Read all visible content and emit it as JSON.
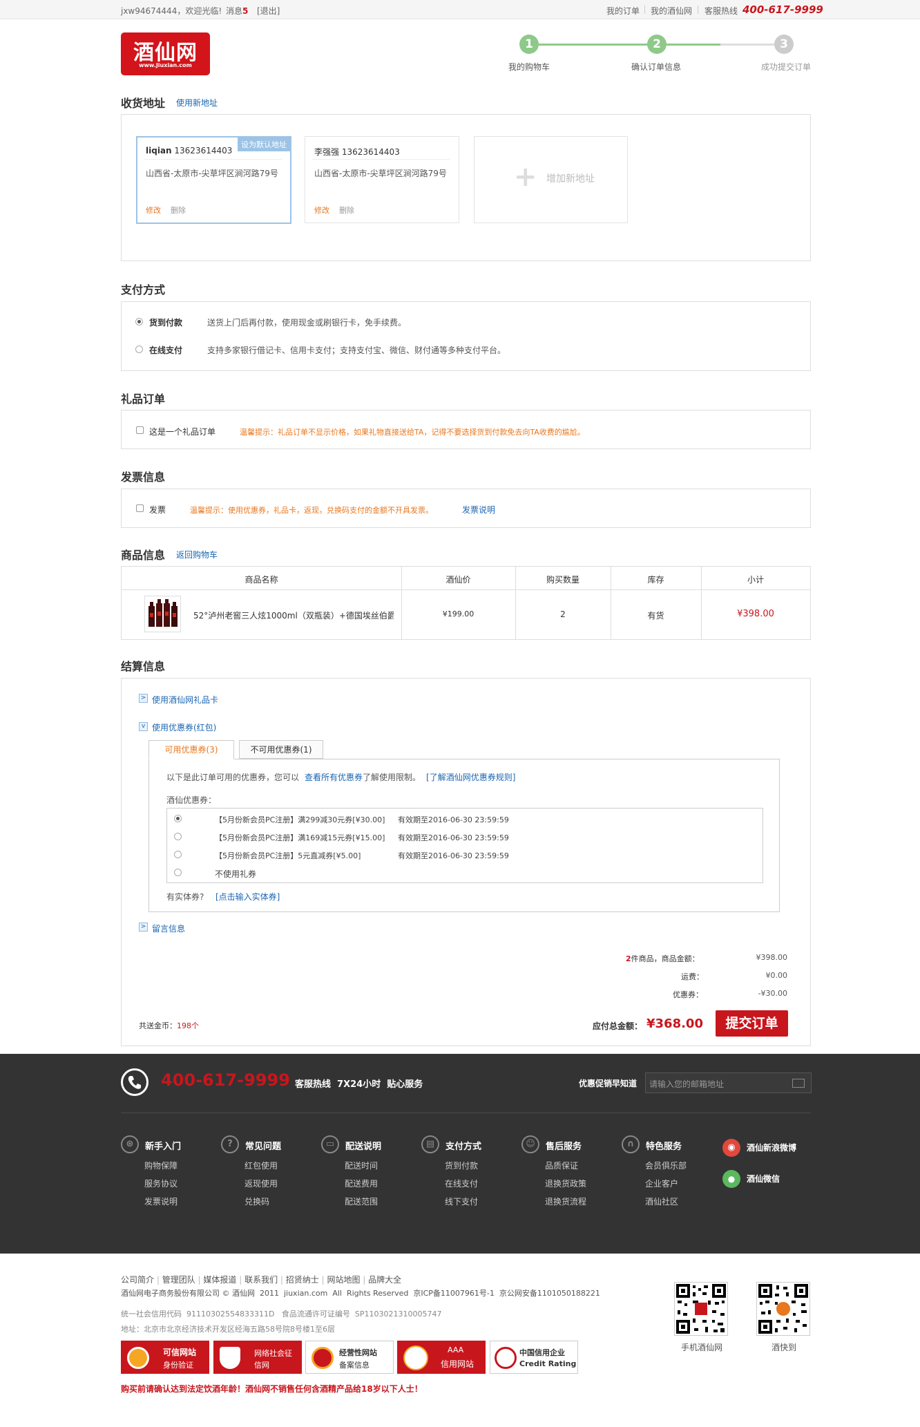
{
  "topbar": {
    "welcome": "jxw94674444，欢迎光临!",
    "messages_label": "消息",
    "messages_count": "5",
    "logout": "[退出]",
    "my_orders": "我的订单",
    "my_account": "我的酒仙网",
    "hotline_label": "客服热线",
    "hotline": "400-617-9999"
  },
  "logo": {
    "cn": "酒仙网",
    "en": "www.Jiuxian.com"
  },
  "steps": [
    {
      "num": "1",
      "label": "我的购物车",
      "state": "done"
    },
    {
      "num": "2",
      "label": "确认订单信息",
      "state": "current"
    },
    {
      "num": "3",
      "label": "成功提交订单",
      "state": "todo"
    }
  ],
  "address": {
    "title": "收货地址",
    "new_link": "使用新地址",
    "cards": [
      {
        "name": "liqian",
        "phone": "13623614403",
        "addr": "山西省-太原市-尖草坪区涧河路79号",
        "edit": "修改",
        "delete": "删除",
        "set_default": "设为默认地址"
      },
      {
        "name": "李强强",
        "phone": "13623614403",
        "addr": "山西省-太原市-尖草坪区涧河路79号",
        "edit": "修改",
        "delete": "删除"
      }
    ],
    "add_new": "增加新地址"
  },
  "payment": {
    "title": "支付方式",
    "options": [
      {
        "label": "货到付款",
        "desc": "送货上门后再付款，使用现金或刷银行卡，免手续费。",
        "selected": true
      },
      {
        "label": "在线支付",
        "desc": "支持多家银行借记卡、信用卡支付；支持支付宝、微信、财付通等多种支付平台。",
        "selected": false
      }
    ]
  },
  "gift": {
    "title": "礼品订单",
    "checkbox_label": "这是一个礼品订单",
    "tip": "温馨提示：礼品订单不显示价格，如果礼物直接送给TA，记得不要选择货到付款免去向TA收费的尴尬。"
  },
  "invoice": {
    "title": "发票信息",
    "checkbox_label": "发票",
    "tip": "温馨提示：使用优惠券，礼品卡，返现，兑换码支付的金额不开具发票。",
    "link": "发票说明"
  },
  "products": {
    "title": "商品信息",
    "back_link": "返回购物车",
    "headers": [
      "商品名称",
      "酒仙价",
      "购买数量",
      "库存",
      "小计"
    ],
    "rows": [
      {
        "name": "52°泸州老窖三人炫1000ml（双瓶装）+德国埃丝伯爵…",
        "price": "¥199.00",
        "qty": "2",
        "stock": "有货",
        "subtotal": "¥398.00"
      }
    ]
  },
  "settlement": {
    "title": "结算信息",
    "gift_card": "使用酒仙网礼品卡",
    "coupon_toggle": "使用优惠券(红包)",
    "tabs": [
      "可用优惠券(3)",
      "不可用优惠券(1)"
    ],
    "intro_prefix": "以下是此订单可用的优惠券，您可以",
    "intro_link1": "查看所有优惠券",
    "intro_mid": "了解使用限制。",
    "intro_link2": "[了解酒仙网优惠券规则]",
    "coupon_label": "酒仙优惠券：",
    "coupons": [
      {
        "name": "【5月份新会员PC注册】满299减30元券[¥30.00]",
        "expiry": "有效期至2016-06-30 23:59:59",
        "selected": true
      },
      {
        "name": "【5月份新会员PC注册】满169减15元券[¥15.00]",
        "expiry": "有效期至2016-06-30 23:59:59",
        "selected": false
      },
      {
        "name": "【5月份新会员PC注册】5元直减券[¥5.00]",
        "expiry": "有效期至2016-06-30 23:59:59",
        "selected": false
      }
    ],
    "no_coupon": "不使用礼券",
    "physical_label": "有实体券?",
    "physical_link": "[点击输入实体券]",
    "message": "留言信息",
    "summary": {
      "count": "2",
      "count_suffix": "件商品，商品金额：",
      "goods_amount": "¥398.00",
      "shipping_label": "运费：",
      "shipping": "¥0.00",
      "coupon_label": "优惠券：",
      "coupon": "-¥30.00"
    },
    "gold_label": "共送金币：",
    "gold": "198个",
    "total_label": "应付总金额：",
    "total": "¥368.00",
    "submit": "提交订单"
  },
  "footer_dark": {
    "phone": "400-617-9999",
    "service": "客服热线  7X24小时  贴心服务",
    "promo_label": "优惠促销早知道",
    "email_placeholder": "请输入您的邮箱地址",
    "columns": [
      {
        "icon": "wheel-icon",
        "title": "新手入门",
        "items": [
          "购物保障",
          "服务协议",
          "发票说明"
        ]
      },
      {
        "icon": "question-icon",
        "title": "常见问题",
        "items": [
          "红包使用",
          "返现使用",
          "兑换码"
        ]
      },
      {
        "icon": "truck-icon",
        "title": "配送说明",
        "items": [
          "配送时间",
          "配送费用",
          "配送范围"
        ]
      },
      {
        "icon": "card-icon",
        "title": "支付方式",
        "items": [
          "货到付款",
          "在线支付",
          "线下支付"
        ]
      },
      {
        "icon": "user-icon",
        "title": "售后服务",
        "items": [
          "品质保证",
          "退换货政策",
          "退换货流程"
        ]
      },
      {
        "icon": "headset-icon",
        "title": "特色服务",
        "items": [
          "会员俱乐部",
          "企业客户",
          "酒仙社区"
        ]
      }
    ],
    "social": [
      {
        "icon": "weibo-icon",
        "label": "酒仙新浪微博"
      },
      {
        "icon": "wechat-icon",
        "label": "酒仙微信"
      }
    ]
  },
  "footer": {
    "links": [
      "公司简介",
      "管理团队",
      "媒体报道",
      "联系我们",
      "招贤纳士",
      "网站地图",
      "品牌大全"
    ],
    "copyright": "酒仙网电子商务股份有限公司 © 酒仙网  2011  jiuxian.com  All  Rights Reserved  京ICP备11007961号-1  京公网安备1101050188221",
    "credit_code": "统一社会信用代码  91110302554833311D   食品流通许可证编号  SP1103021310005747",
    "address": "地址：北京市北京经济技术开发区经海五路58号院8号楼1至6层",
    "badges": [
      {
        "l1": "可信网站",
        "l2": "身份验证",
        "style": "red"
      },
      {
        "l1": "网络社会征",
        "l2": "信网",
        "style": "red"
      },
      {
        "l1": "经营性网站",
        "l2": "备案信息",
        "style": "white"
      },
      {
        "l1": "AAA",
        "l2": "信用网站",
        "style": "red"
      },
      {
        "l1": "中国信用企业",
        "l2": "Credit Rating",
        "style": "white"
      }
    ],
    "warning": "购买前请确认达到法定饮酒年龄！酒仙网不销售任何含酒精产品给18岁以下人士！",
    "qr": [
      {
        "label": "手机酒仙网"
      },
      {
        "label": "酒快到"
      }
    ]
  },
  "colors": {
    "brand_red": "#c8161d",
    "link_blue": "#1a66b3",
    "step_green": "#8ec98a",
    "tip_orange": "#e8771e",
    "footer_dark": "#333333"
  }
}
